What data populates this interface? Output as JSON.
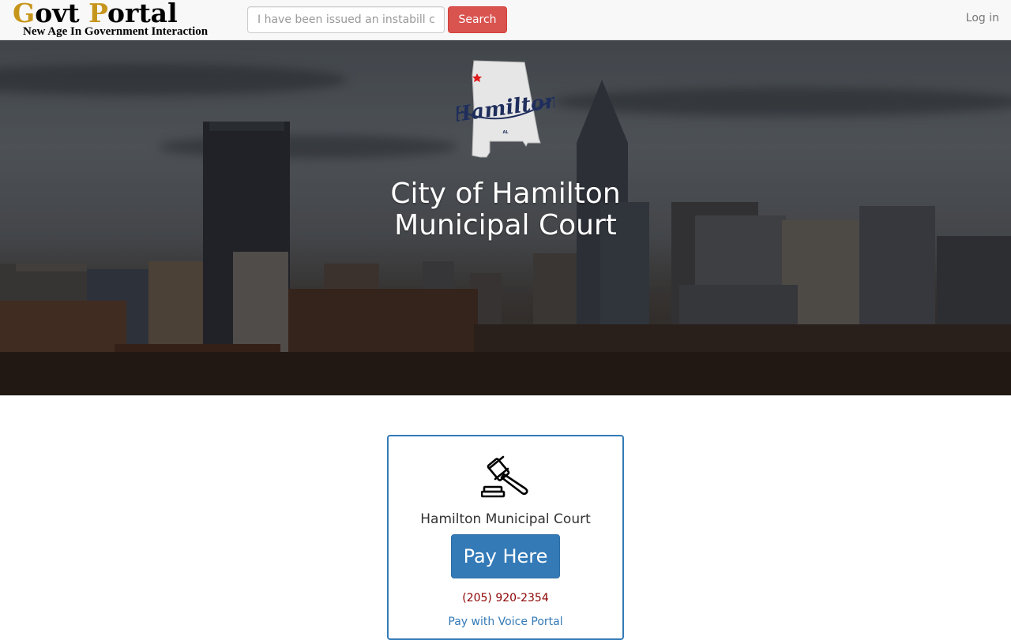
{
  "navbar": {
    "brand": {
      "title_g": "G",
      "title_ovt": "ovt ",
      "title_p": "P",
      "title_ortal": "ortal",
      "tagline": "New Age In Government Interaction",
      "accent_color": "#c6951b"
    },
    "search": {
      "placeholder": "I have been issued an instabill citation",
      "button_label": "Search"
    },
    "login_label": "Log in"
  },
  "hero": {
    "logo_text": "Hamilton",
    "logo_state": "AL",
    "title_line1": "City of Hamilton",
    "title_line2": "Municipal Court"
  },
  "card": {
    "icon": "gavel-icon",
    "title": "Hamilton Municipal Court",
    "pay_button": "Pay Here",
    "phone": "(205) 920-2354",
    "voice_link": "Pay with Voice Portal"
  },
  "colors": {
    "primary": "#337ab7",
    "danger": "#d9534f",
    "phone": "#8b0000"
  }
}
